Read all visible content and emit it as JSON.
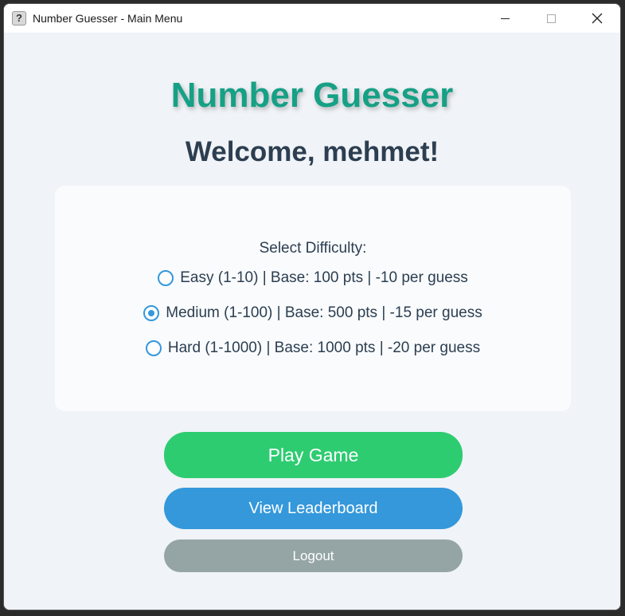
{
  "window": {
    "title": "Number Guesser - Main Menu",
    "app_icon": "?"
  },
  "header": {
    "app_title": "Number Guesser",
    "welcome": "Welcome, mehmet!"
  },
  "difficulty": {
    "label": "Select Difficulty:",
    "selected": "medium",
    "options": [
      {
        "id": "easy",
        "label": "Easy (1-10) | Base: 100 pts | -10 per guess",
        "checked": false
      },
      {
        "id": "medium",
        "label": "Medium (1-100) | Base: 500 pts | -15 per guess",
        "checked": true
      },
      {
        "id": "hard",
        "label": "Hard (1-1000) | Base: 1000 pts | -20 per guess",
        "checked": false
      }
    ]
  },
  "buttons": {
    "play": "Play Game",
    "leaderboard": "View Leaderboard",
    "logout": "Logout"
  },
  "colors": {
    "title": "#16a085",
    "text": "#2c3e50",
    "play": "#2ecc71",
    "leaderboard": "#3498db",
    "logout": "#95a5a6",
    "radio": "#3498db"
  }
}
